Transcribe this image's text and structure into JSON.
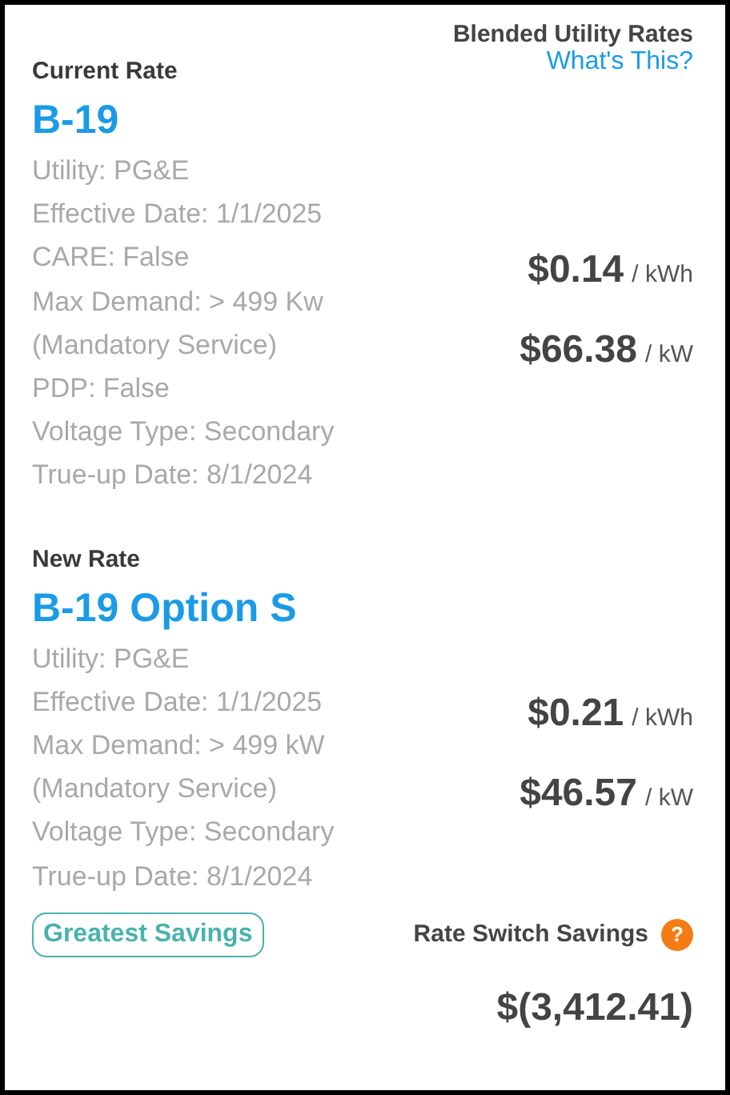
{
  "header": {
    "title": "Blended Utility Rates",
    "link": "What's This?"
  },
  "rates": [
    {
      "label": "Current Rate",
      "name": "B-19",
      "details": [
        "Utility: PG&E",
        "Effective Date: 1/1/2025",
        "CARE: False",
        "Max Demand: > 499 Kw",
        "(Mandatory Service)",
        "PDP: False",
        "Voltage Type: Secondary",
        "True-up Date: 8/1/2024"
      ],
      "prices": [
        {
          "value": "$0.14",
          "unit": "/ kWh"
        },
        {
          "value": "$66.38",
          "unit": "/ kW"
        }
      ]
    },
    {
      "label": "New Rate",
      "name": "B-19 Option S",
      "details": [
        "Utility: PG&E",
        "Effective Date: 1/1/2025",
        "Max Demand: > 499 kW",
        "(Mandatory Service)",
        "Voltage Type: Secondary",
        "True-up Date: 8/1/2024"
      ],
      "prices": [
        {
          "value": "$0.21",
          "unit": "/ kWh"
        },
        {
          "value": "$46.57",
          "unit": "/ kW"
        }
      ]
    }
  ],
  "badge": "Greatest Savings",
  "savings": {
    "label": "Rate Switch Savings",
    "help": "?",
    "value": "$(3,412.41)"
  }
}
